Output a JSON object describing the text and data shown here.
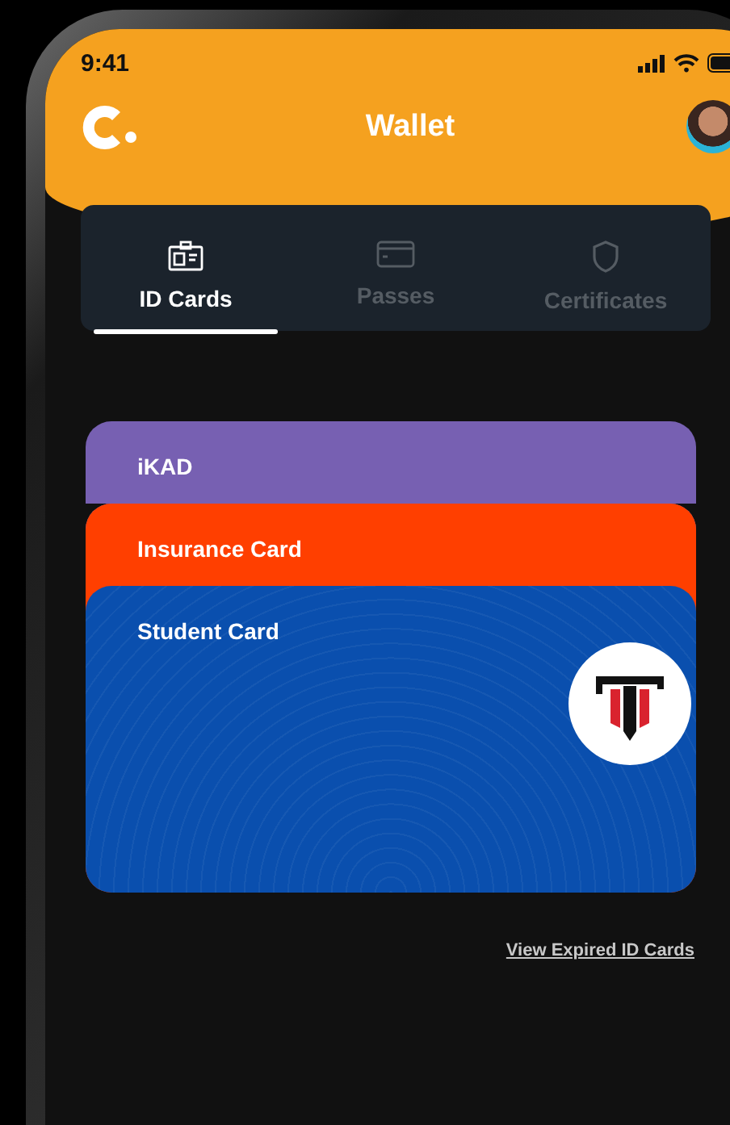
{
  "status_bar": {
    "time": "9:41"
  },
  "header": {
    "title": "Wallet"
  },
  "tabs": [
    {
      "label": "ID Cards",
      "kind": "id",
      "selected": true
    },
    {
      "label": "Passes",
      "kind": "pass",
      "selected": false
    },
    {
      "label": "Certificates",
      "kind": "certificate",
      "selected": false
    }
  ],
  "cards": [
    {
      "name": "iKAD",
      "color": "#7760b2",
      "emblem": false
    },
    {
      "name": "Insurance Card",
      "color": "#ff3f00",
      "emblem": false
    },
    {
      "name": "Student Card",
      "color": "#0a4fae",
      "emblem": true
    }
  ],
  "link": "View Expired ID Cards"
}
